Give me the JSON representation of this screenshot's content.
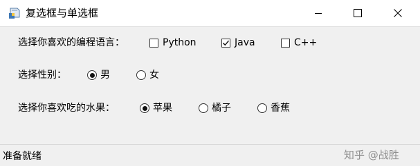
{
  "window": {
    "title": "复选框与单选框",
    "icon": "python-app-icon",
    "controls": [
      "minimize-icon",
      "maximize-icon",
      "close-icon"
    ]
  },
  "languages": {
    "label": "选择你喜欢的编程语言：",
    "options": [
      {
        "label": "Python",
        "checked": false
      },
      {
        "label": "Java",
        "checked": true
      },
      {
        "label": "C++",
        "checked": false
      }
    ]
  },
  "gender": {
    "label": "选择性别：",
    "options": [
      {
        "label": "男",
        "selected": true
      },
      {
        "label": "女",
        "selected": false
      }
    ]
  },
  "fruits": {
    "label": "选择你喜欢吃的水果：",
    "options": [
      {
        "label": "苹果",
        "selected": true
      },
      {
        "label": "橘子",
        "selected": false
      },
      {
        "label": "香蕉",
        "selected": false
      }
    ]
  },
  "statusbar": {
    "text": "准备就绪",
    "watermark": "知乎 @战胜"
  }
}
